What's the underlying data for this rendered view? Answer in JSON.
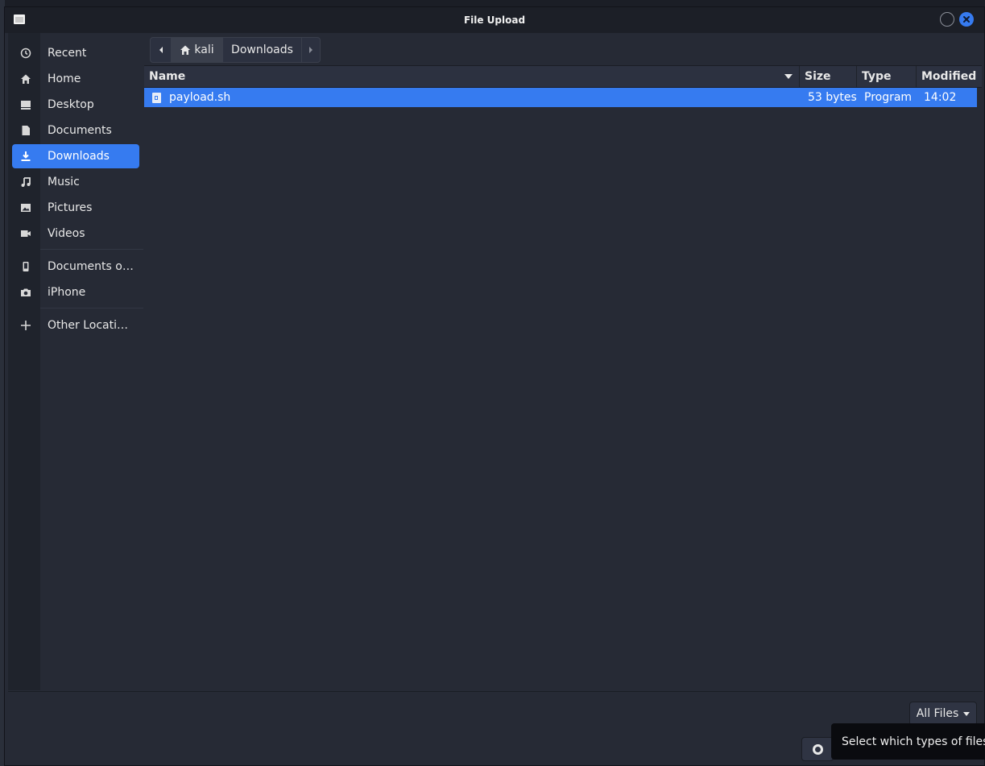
{
  "window": {
    "title": "File Upload"
  },
  "sidebar": {
    "items": [
      {
        "label": "Recent",
        "icon": "clock-icon"
      },
      {
        "label": "Home",
        "icon": "home-icon"
      },
      {
        "label": "Desktop",
        "icon": "desktop-icon"
      },
      {
        "label": "Documents",
        "icon": "document-icon"
      },
      {
        "label": "Downloads",
        "icon": "download-icon",
        "active": true
      },
      {
        "label": "Music",
        "icon": "music-icon"
      },
      {
        "label": "Pictures",
        "icon": "picture-icon"
      },
      {
        "label": "Videos",
        "icon": "video-icon"
      },
      {
        "label": "Documents o…",
        "icon": "phone-icon"
      },
      {
        "label": "iPhone",
        "icon": "camera-icon"
      },
      {
        "label": "Other Locations",
        "icon": "plus-icon"
      }
    ]
  },
  "pathbar": {
    "home_label": "kali",
    "current_label": "Downloads"
  },
  "columns": {
    "name": "Name",
    "size": "Size",
    "type": "Type",
    "modified": "Modified"
  },
  "files": [
    {
      "name": "payload.sh",
      "size": "53 bytes",
      "type": "Program",
      "modified": "14:02",
      "selected": true
    }
  ],
  "filter": {
    "label": "All Files"
  },
  "tooltip": {
    "text": "Select which types of files a"
  },
  "colors": {
    "accent": "#367bf0",
    "background": "#262a35",
    "titlebar": "#1c1f27"
  }
}
